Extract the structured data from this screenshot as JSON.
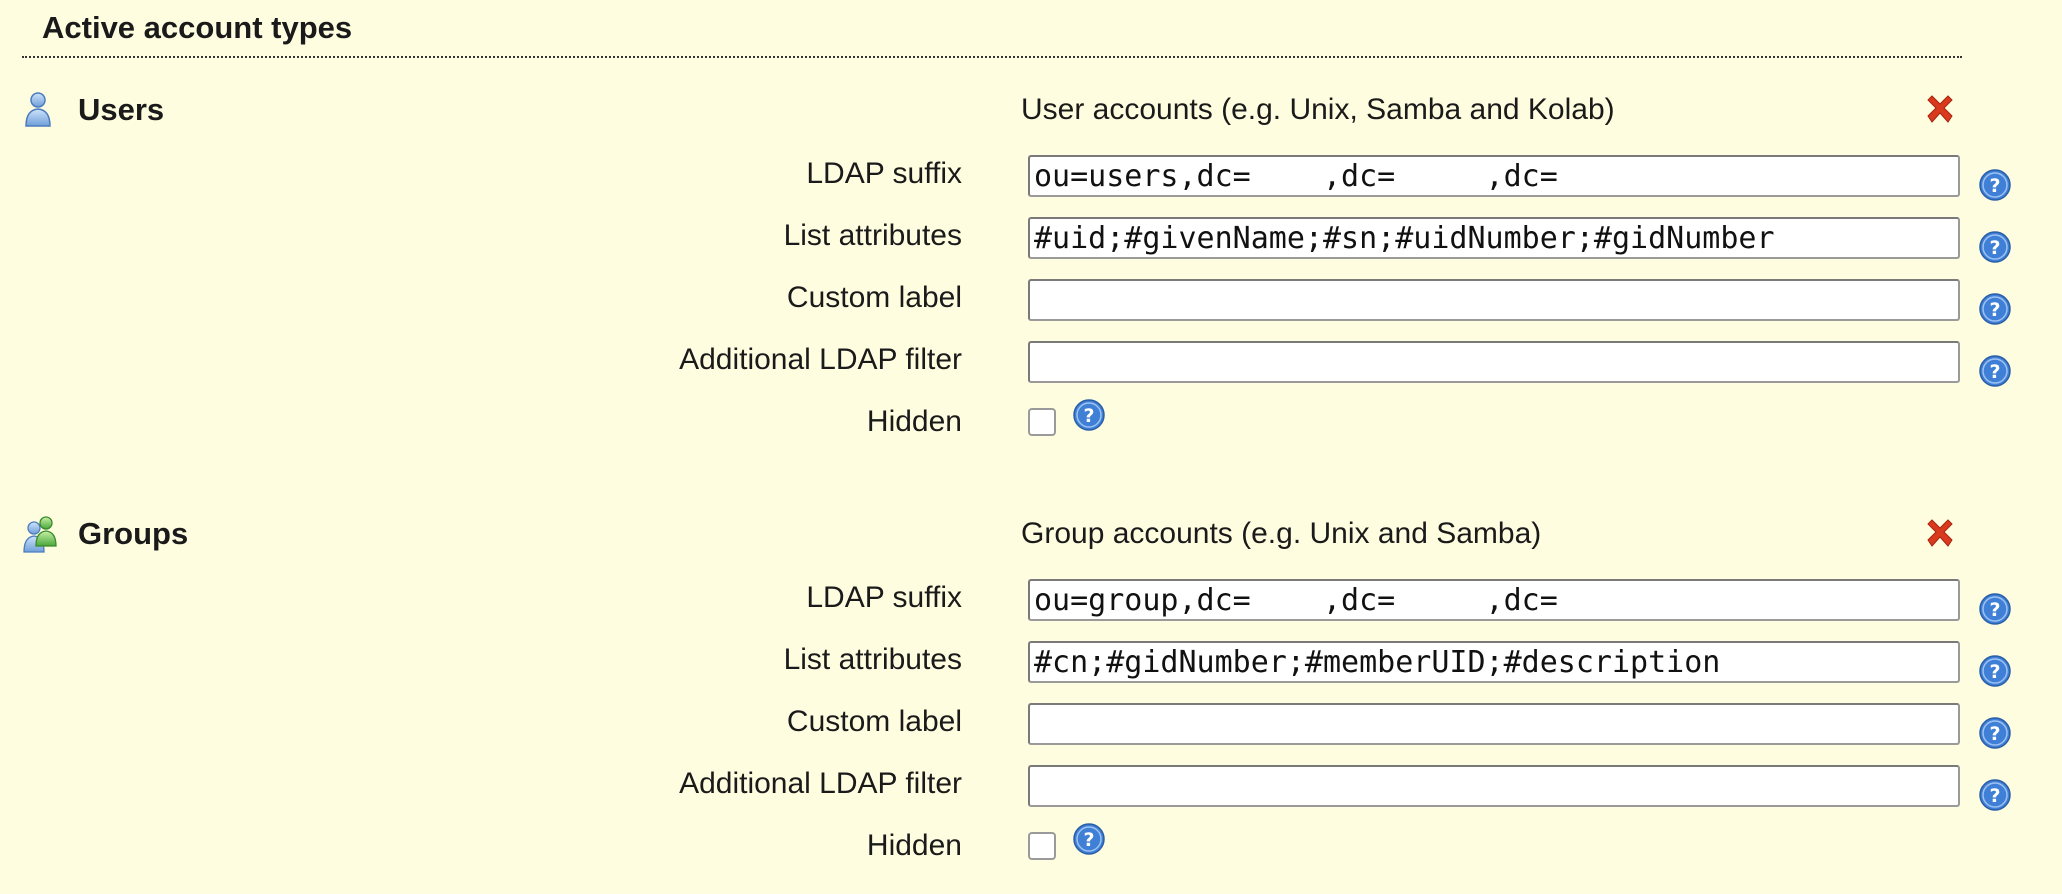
{
  "section": {
    "title": "Active account types"
  },
  "account_types": [
    {
      "name": "Users",
      "icon": "user-icon",
      "description": "User accounts (e.g. Unix, Samba and Kolab)",
      "fields": {
        "ldap_suffix_label": "LDAP suffix",
        "ldap_suffix_value": "ou=users,dc=    ,dc=     ,dc=",
        "list_attributes_label": "List attributes",
        "list_attributes_value": "#uid;#givenName;#sn;#uidNumber;#gidNumber",
        "custom_label_label": "Custom label",
        "custom_label_value": "",
        "additional_filter_label": "Additional LDAP filter",
        "additional_filter_value": "",
        "hidden_label": "Hidden",
        "hidden_checked": false
      }
    },
    {
      "name": "Groups",
      "icon": "group-icon",
      "description": "Group accounts (e.g. Unix and Samba)",
      "fields": {
        "ldap_suffix_label": "LDAP suffix",
        "ldap_suffix_value": "ou=group,dc=    ,dc=     ,dc=",
        "list_attributes_label": "List attributes",
        "list_attributes_value": "#cn;#gidNumber;#memberUID;#description",
        "custom_label_label": "Custom label",
        "custom_label_value": "",
        "additional_filter_label": "Additional LDAP filter",
        "additional_filter_value": "",
        "hidden_label": "Hidden",
        "hidden_checked": false
      }
    }
  ],
  "colors": {
    "background": "#FFFDE0",
    "delete": "#D93A1E",
    "help": "#3F7FD6"
  }
}
